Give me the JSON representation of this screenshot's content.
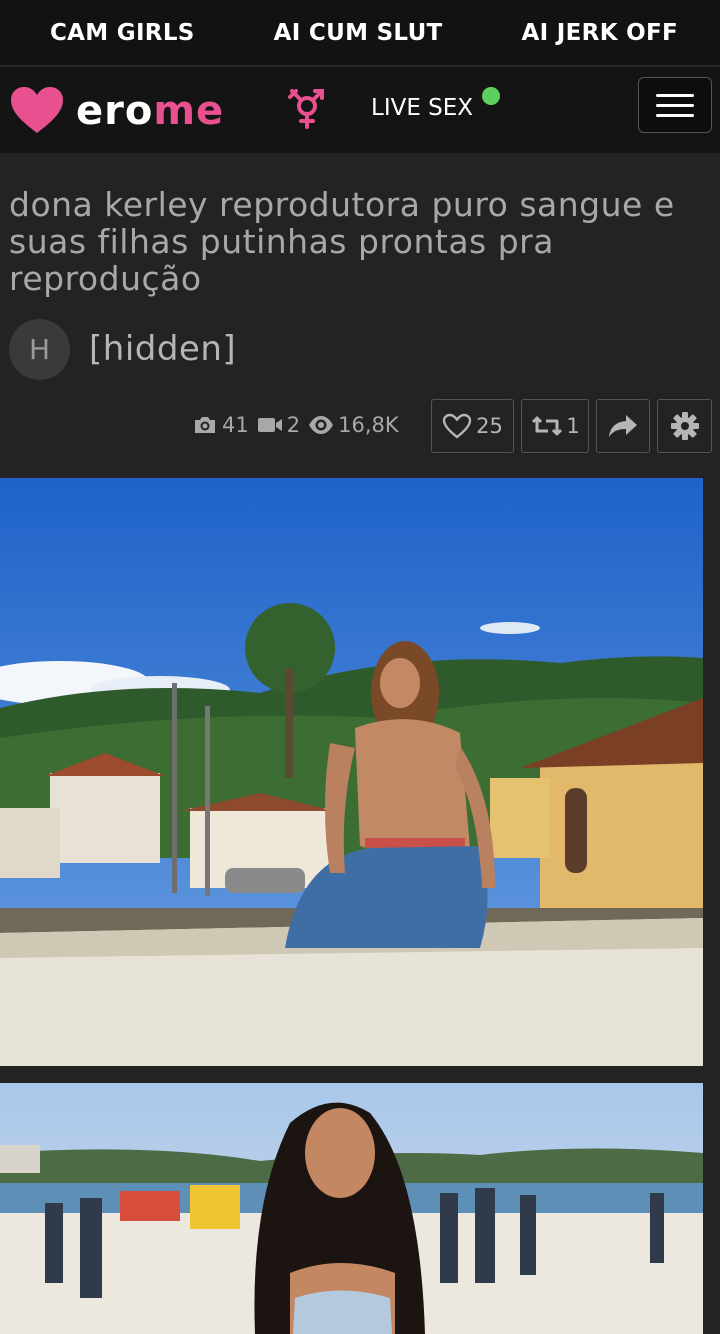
{
  "promo": {
    "links": [
      "CAM GIRLS",
      "AI CUM SLUT",
      "AI JERK OFF"
    ]
  },
  "header": {
    "logo_white": "ero",
    "logo_pink": "me",
    "live_label": "LIVE SEX"
  },
  "album": {
    "title": "dona kerley reprodutora puro sangue e suas filhas putinhas prontas pra reprodução",
    "user_initial": "H",
    "username": "[hidden]",
    "photos": "41",
    "videos": "2",
    "views": "16,8K",
    "likes": "25",
    "reposts": "1"
  },
  "icons": {
    "photo": "camera-icon",
    "video": "video-camera-icon",
    "views": "eye-icon",
    "like": "heart-icon",
    "repost": "retweet-icon",
    "share": "share-arrow-icon",
    "settings": "gear-icon"
  },
  "colors": {
    "brand_pink": "#e9508f",
    "live_dot": "#5ccf5c",
    "background": "#232323"
  }
}
